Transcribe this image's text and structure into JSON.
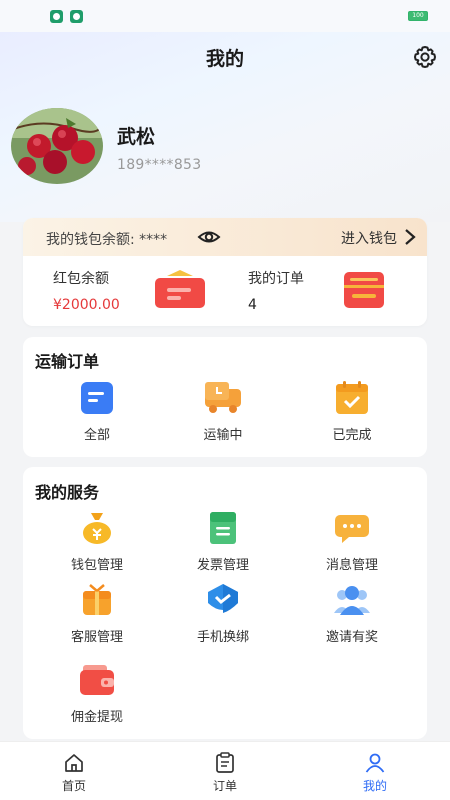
{
  "colors": {
    "accent": "#2f6cf5",
    "price_red": "#e5393a",
    "wallet_bg": "#f8e3cc"
  },
  "status_bar": {
    "battery": "100"
  },
  "header": {
    "title": "我的",
    "settings_icon": "gear-icon"
  },
  "user": {
    "name": "武松",
    "phone": "189****853",
    "avatar_icon": "apple-photo"
  },
  "wallet": {
    "balance_label": "我的钱包余额: ****",
    "eye_icon": "eye-icon",
    "enter_label": "进入钱包",
    "red_packet_label": "红包余额",
    "red_packet_value": "¥2000.00",
    "orders_label": "我的订单",
    "orders_value": "4"
  },
  "transport": {
    "title": "运输订单",
    "items": [
      {
        "label": "全部",
        "icon": "document-icon"
      },
      {
        "label": "运输中",
        "icon": "truck-icon"
      },
      {
        "label": "已完成",
        "icon": "calendar-check-icon"
      }
    ]
  },
  "services": {
    "title": "我的服务",
    "items": [
      {
        "label": "钱包管理",
        "icon": "money-bag-icon"
      },
      {
        "label": "发票管理",
        "icon": "invoice-icon"
      },
      {
        "label": "消息管理",
        "icon": "message-icon"
      },
      {
        "label": "客服管理",
        "icon": "gift-icon"
      },
      {
        "label": "手机换绑",
        "icon": "shield-check-icon"
      },
      {
        "label": "邀请有奖",
        "icon": "users-icon"
      },
      {
        "label": "佣金提现",
        "icon": "wallet-icon"
      }
    ]
  },
  "tabs": [
    {
      "label": "首页",
      "icon": "home-icon"
    },
    {
      "label": "订单",
      "icon": "clipboard-icon"
    },
    {
      "label": "我的",
      "icon": "user-icon"
    }
  ]
}
